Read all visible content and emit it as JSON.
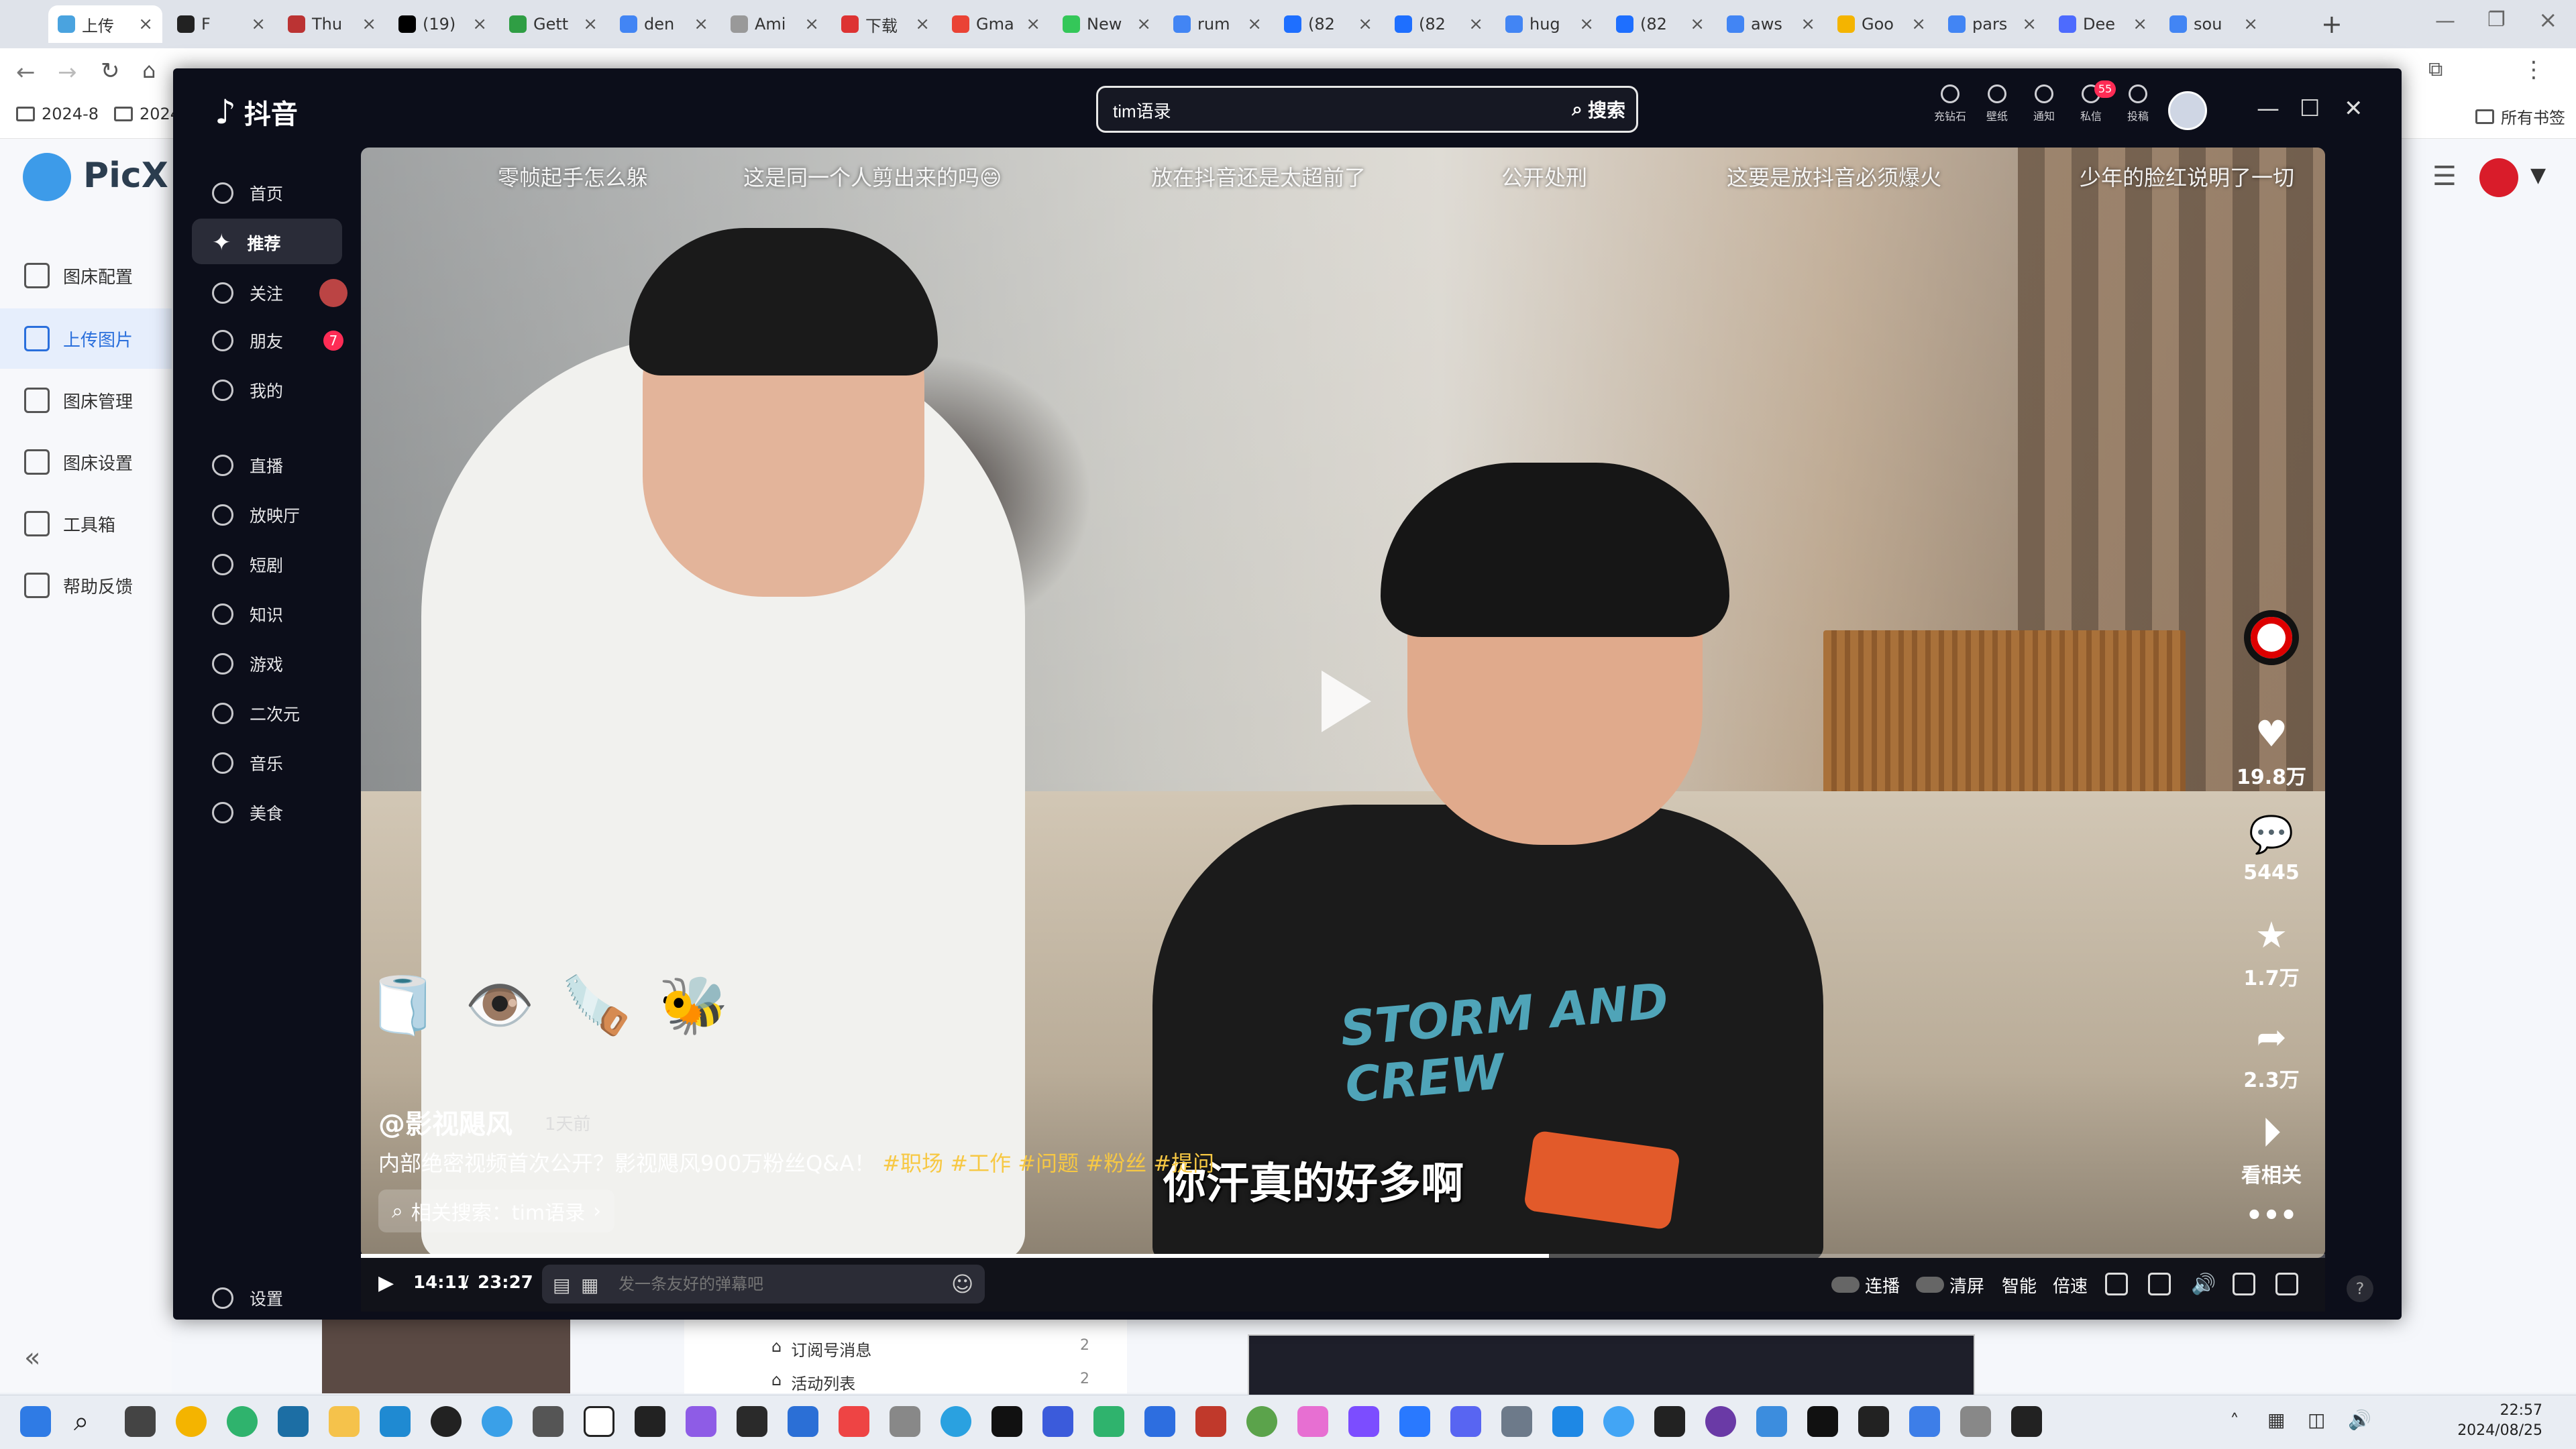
{
  "browser": {
    "tabs": [
      "上传",
      "F",
      "Thu",
      "(19)",
      "Gett",
      "den",
      "Ami",
      "下载",
      "Gma",
      "New",
      "rum",
      "(82",
      "(82",
      "hug",
      "(82",
      "aws",
      "Goo",
      "pars",
      "Dee",
      "sou"
    ],
    "bookmarks": [
      "2024-8",
      "2024"
    ],
    "bookmarks_right": "所有书签"
  },
  "picx": {
    "app_name": "PicX",
    "menu": [
      "图床配置",
      "上传图片",
      "图床管理",
      "图床设置",
      "工具箱",
      "帮助反馈"
    ],
    "active_index": 1
  },
  "douyin": {
    "logo": "抖音",
    "search": {
      "value": "tim语录",
      "button": "搜索"
    },
    "top_icons": [
      "充钻石",
      "壁纸",
      "通知",
      "私信",
      "投稿"
    ],
    "message_badge": "55",
    "sidebar": [
      {
        "label": "首页"
      },
      {
        "label": "推荐"
      },
      {
        "label": "关注"
      },
      {
        "label": "朋友",
        "badge": "7"
      },
      {
        "label": "我的"
      },
      {
        "label": "直播"
      },
      {
        "label": "放映厅"
      },
      {
        "label": "短剧"
      },
      {
        "label": "知识"
      },
      {
        "label": "游戏"
      },
      {
        "label": "二次元"
      },
      {
        "label": "音乐"
      },
      {
        "label": "美食"
      }
    ],
    "settings": "设置",
    "danmu": [
      "零帧起手怎么躲",
      "这是同一个人剪出来的吗😄",
      "放在抖音还是太超前了",
      "公开处刑",
      "这要是放抖音必须爆火",
      "少年的脸红说明了一切"
    ],
    "video": {
      "author": "@影视飓风",
      "ago": "1天前",
      "title": "内部绝密视频首次公开？影视飓风900万粉丝Q&A！",
      "tags": [
        "#职场",
        "#工作",
        "#问题",
        "#粉丝",
        "#提问"
      ],
      "related": "相关搜索：tim语录",
      "subtitle": "你汗真的好多啊",
      "shirt_text": "STORM AND CREW",
      "time_current": "14:11",
      "time_total": "23:27",
      "progress": 0.605,
      "danmu_placeholder": "发一条友好的弹幕吧"
    },
    "stats": {
      "likes": "19.8万",
      "comments": "5445",
      "favorites": "1.7万",
      "shares": "2.3万",
      "related": "看相关"
    },
    "controls": [
      "连播",
      "清屏",
      "智能",
      "倍速"
    ]
  },
  "behind": {
    "items": [
      "订阅号消息",
      "活动列表"
    ],
    "counts": [
      "2",
      "2"
    ]
  },
  "clock": {
    "time": "22:57",
    "date": "2024/08/25"
  }
}
